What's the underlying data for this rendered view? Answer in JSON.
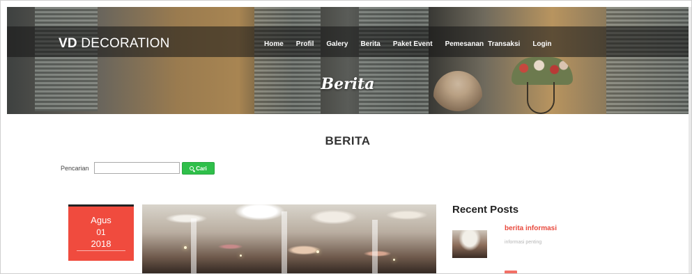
{
  "brand": {
    "bold": "VD",
    "rest": "DECORATION"
  },
  "nav": [
    {
      "label": "Home"
    },
    {
      "label": "Profil"
    },
    {
      "label": "Galery"
    },
    {
      "label": "Berita"
    },
    {
      "label": "Paket Event"
    },
    {
      "label": "Pemesanan"
    },
    {
      "label": "Transaksi"
    },
    {
      "label": "Login"
    }
  ],
  "hero": {
    "title": "Berita"
  },
  "page": {
    "heading": "BERITA"
  },
  "search": {
    "label": "Pencarian",
    "value": "",
    "button_label": "Cari"
  },
  "post": {
    "month": "Agus",
    "day": "01",
    "year": "2018"
  },
  "sidebar": {
    "recent_title": "Recent Posts",
    "items": [
      {
        "title": "berita informasi",
        "subtitle": "informasi penting"
      }
    ]
  },
  "colors": {
    "accent": "#f04b3e",
    "search_button": "#2fbf4a",
    "nav_text": "#ffffff"
  }
}
